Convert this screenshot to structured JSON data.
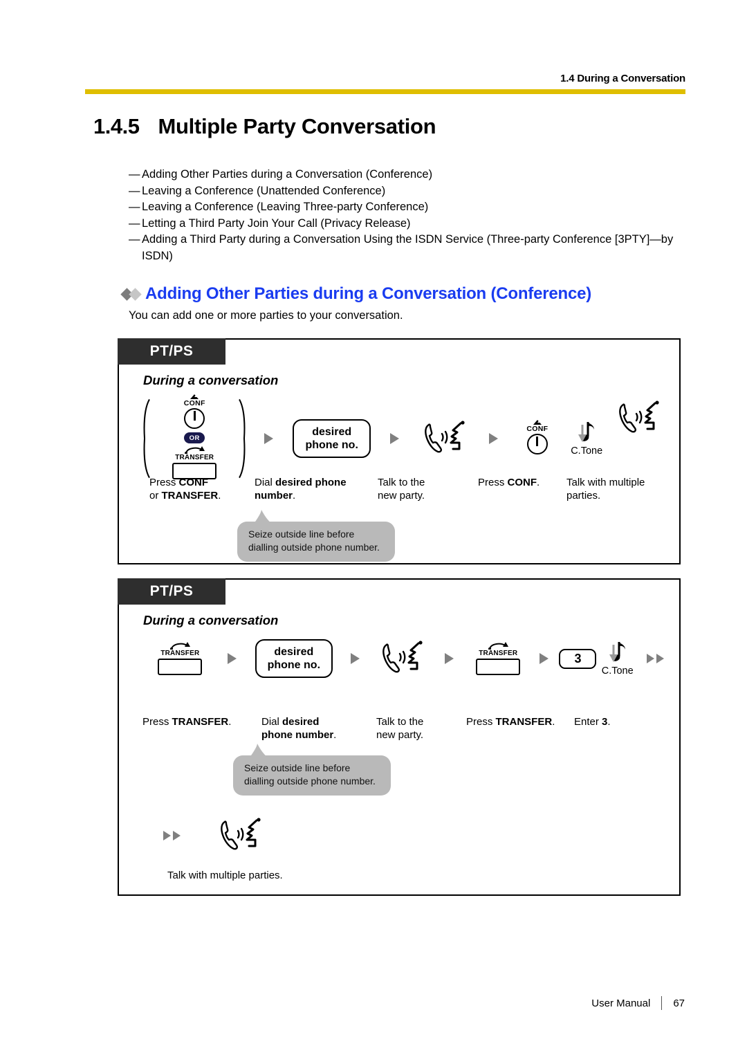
{
  "header": {
    "running_head": "1.4 During a Conversation",
    "rule_color": "#dfbe00"
  },
  "title": {
    "number": "1.4.5",
    "text": "Multiple Party Conversation"
  },
  "topic_list": {
    "dash": "—",
    "items": [
      "Adding Other Parties during a Conversation (Conference)",
      "Leaving a Conference (Unattended Conference)",
      "Leaving a Conference (Leaving Three-party Conference)",
      "Letting a Third Party Join Your Call (Privacy Release)",
      "Adding a Third Party during a Conversation Using the ISDN Service (Three-party Conference [3PTY]—by ISDN)"
    ]
  },
  "section": {
    "heading": "Adding Other Parties during a Conversation (Conference)",
    "heading_color": "#1a3cf0",
    "intro": "You can add one or more parties to your conversation."
  },
  "procedures": [
    {
      "tab_label": "PT/PS",
      "state_label": "During a conversation",
      "steps": [
        {
          "glyph": "conf-or-transfer-key",
          "conf_label": "CONF",
          "or_label": "OR",
          "transfer_label": "TRANSFER",
          "caption_lines": [
            "Press CONF",
            "or TRANSFER."
          ],
          "caption_bold": [
            "CONF",
            "TRANSFER"
          ]
        },
        {
          "glyph": "keycap",
          "keycap_lines": [
            "desired",
            "phone no."
          ],
          "caption_lines": [
            "Dial desired phone",
            "number."
          ],
          "caption_bold": [
            "desired phone",
            "number"
          ]
        },
        {
          "glyph": "talk-icon",
          "caption_lines": [
            "Talk to the",
            "new party."
          ],
          "caption_bold": []
        },
        {
          "glyph": "conf-key",
          "conf_label": "CONF",
          "caption_lines": [
            "Press CONF."
          ],
          "caption_bold": [
            "CONF"
          ]
        },
        {
          "glyph": "tone-and-talk",
          "tone_label": "C.Tone",
          "caption_lines": [
            "Talk with multiple",
            "parties."
          ],
          "caption_bold": []
        }
      ],
      "bubble": {
        "line1": "Seize outside line before",
        "line2": "dialling outside phone number."
      }
    },
    {
      "tab_label": "PT/PS",
      "state_label": "During a conversation",
      "steps": [
        {
          "glyph": "transfer-key",
          "transfer_label": "TRANSFER",
          "caption_lines": [
            "Press TRANSFER."
          ],
          "caption_bold": [
            "TRANSFER"
          ]
        },
        {
          "glyph": "keycap",
          "keycap_lines": [
            "desired",
            "phone no."
          ],
          "caption_lines": [
            "Dial desired",
            "phone number."
          ],
          "caption_bold": [
            "desired",
            "phone number"
          ]
        },
        {
          "glyph": "talk-icon",
          "caption_lines": [
            "Talk to the",
            "new party."
          ],
          "caption_bold": []
        },
        {
          "glyph": "transfer-key",
          "transfer_label": "TRANSFER",
          "caption_lines": [
            "Press TRANSFER."
          ],
          "caption_bold": [
            "TRANSFER"
          ]
        },
        {
          "glyph": "keycap-num-and-tone",
          "keycap_value": "3",
          "tone_label": "C.Tone",
          "caption_lines": [
            "Enter 3."
          ],
          "caption_bold": [
            "3"
          ]
        }
      ],
      "bubble": {
        "line1": "Seize outside line before",
        "line2": "dialling outside phone number."
      },
      "final_step": {
        "glyph": "talk-icon",
        "caption": "Talk with multiple parties."
      }
    }
  ],
  "footer": {
    "doc_name": "User Manual",
    "page_number": "67"
  }
}
